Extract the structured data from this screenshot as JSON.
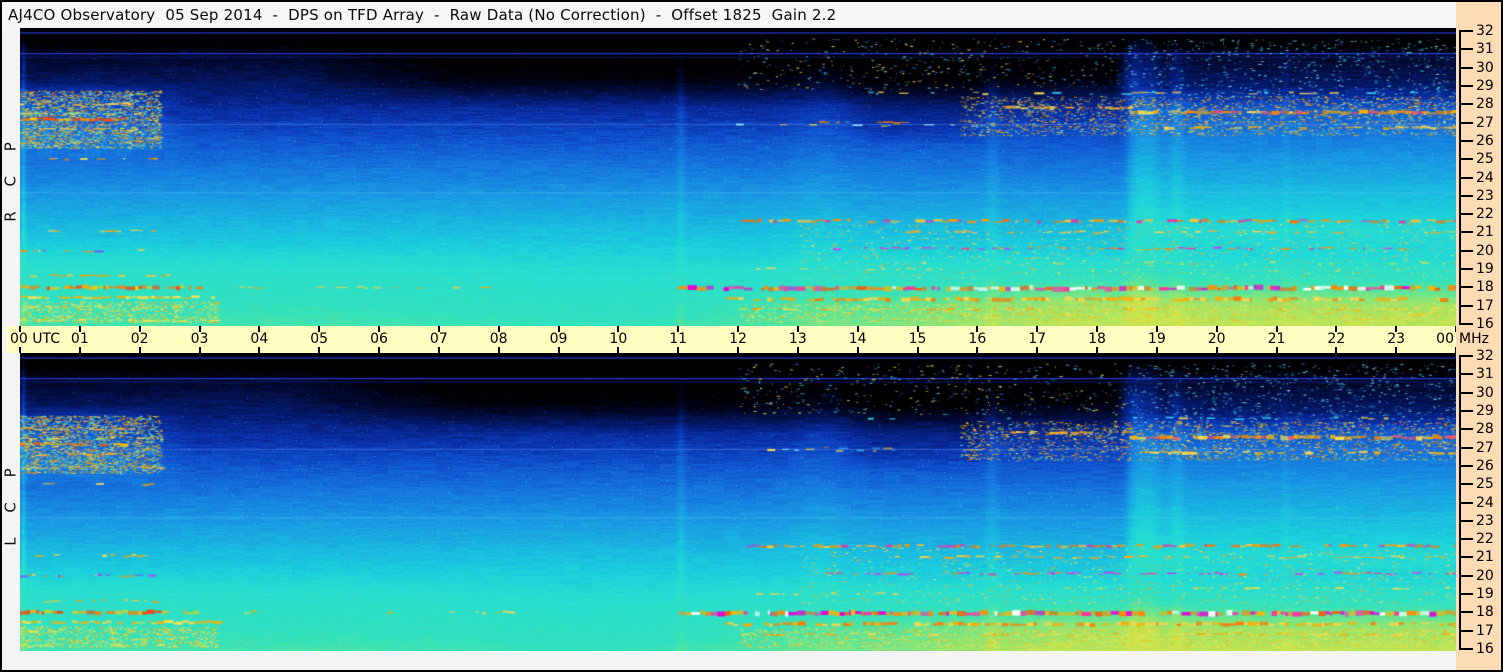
{
  "title": "AJ4CO Observatory  05 Sep 2014  -  DPS on TFD Array  -  Raw Data (No Correction)  -  Offset 1825  Gain 2.2",
  "panels": [
    {
      "id": "rcp",
      "label": "R C P",
      "noise_seed": 1234567
    },
    {
      "id": "lcp",
      "label": "L C P",
      "noise_seed": 7654321
    }
  ],
  "time_axis": {
    "labels": [
      "00 UTC",
      "01",
      "02",
      "03",
      "04",
      "05",
      "06",
      "07",
      "08",
      "09",
      "10",
      "11",
      "12",
      "13",
      "14",
      "15",
      "16",
      "17",
      "18",
      "19",
      "20",
      "21",
      "22",
      "23",
      "00"
    ]
  },
  "freq_axis": {
    "unit": "MHz",
    "ticks": [
      "32",
      "31",
      "30",
      "29",
      "28",
      "27",
      "26",
      "25",
      "24",
      "23",
      "22",
      "21",
      "20",
      "19",
      "18",
      "17",
      "16"
    ]
  },
  "colors": {
    "axis_band_bg": "#ffffc2",
    "sidebar_bg": "#fcdcb4",
    "page_bg": "#f4f4f4",
    "tick": "#000000",
    "text": "#000000"
  },
  "chart_data": {
    "type": "heatmap",
    "title": "AJ4CO Observatory dual-polarization dynamic spectrum (DPS on TFD Array), 05 Sep 2014, raw data, offset 1825, gain 2.2",
    "x": {
      "label": "UTC",
      "range_hours": [
        0,
        24
      ],
      "tick_step": 1
    },
    "y": {
      "label": "MHz",
      "range_mhz": [
        16,
        32
      ],
      "tick_step": 1,
      "orientation": "32 MHz at top"
    },
    "panel_series": [
      "RCP",
      "LCP"
    ],
    "notable_features": [
      "Interference/emission cluster 00:00-02:30 UTC between 25.5-28.7 MHz with red-orange line near 27.2 MHz (both polarizations)",
      "Quiet near-black region above ~28 MHz from ~05:00 until ~18:30 UTC, then brighter after 18:30",
      "Shortwave-band speckle 26.3-28.4 MHz strengthening after 16:00, dense orange band near 27.5 MHz after 18:30 UTC",
      "Strong broadband band near 18 MHz (orange/magenta/white) from 11:00 UTC to end of day",
      "Secondary bands near 21.6, 20.1 and 17.3 MHz in the afternoon sector",
      "Background gradient: black (32 MHz) through blue to cyan (16 MHz); becomes yellow-green at low frequencies late in the day",
      "Bright vertical columns near 18.6-19.0 and 19.3 UTC; faint light column at 11:00 UTC"
    ],
    "render": {
      "colormap": [
        {
          "p": 0.0,
          "c": "#000002"
        },
        {
          "p": 0.05,
          "c": "#01051a"
        },
        {
          "p": 0.1,
          "c": "#020a30"
        },
        {
          "p": 0.16,
          "c": "#041457"
        },
        {
          "p": 0.22,
          "c": "#06207f"
        },
        {
          "p": 0.28,
          "c": "#0a2fa5"
        },
        {
          "p": 0.34,
          "c": "#0e47c4"
        },
        {
          "p": 0.4,
          "c": "#1260d5"
        },
        {
          "p": 0.47,
          "c": "#167ade"
        },
        {
          "p": 0.54,
          "c": "#1992e2"
        },
        {
          "p": 0.61,
          "c": "#1aa9e2"
        },
        {
          "p": 0.68,
          "c": "#1bbfe0"
        },
        {
          "p": 0.75,
          "c": "#1dd3dc"
        },
        {
          "p": 0.83,
          "c": "#27ded0"
        },
        {
          "p": 0.92,
          "c": "#2ee0c6"
        },
        {
          "p": 1.0,
          "c": "#32e2c0"
        },
        {
          "p": 1.1,
          "c": "#55e59e"
        },
        {
          "p": 1.2,
          "c": "#8ce677"
        },
        {
          "p": 1.32,
          "c": "#c8e44e"
        }
      ],
      "regions": [
        {
          "t0": 4.5,
          "rt0": 3.0,
          "t1": 18.45,
          "rt1": 0.18,
          "f0": 27.8,
          "rf0": 1.6,
          "f1": 34.0,
          "rf1": 1.0,
          "amt": -0.145
        },
        {
          "t0": -2.0,
          "rt0": 0.1,
          "t1": 26.0,
          "rt1": 0.5,
          "f0": 30.7,
          "rf0": 0.9,
          "f1": 34.0,
          "rf1": 1.0,
          "amt": -0.1
        },
        {
          "t0": -2.0,
          "rt0": 0.1,
          "t1": 2.9,
          "rt1": 1.3,
          "f0": 24.8,
          "rf0": 1.3,
          "f1": 29.4,
          "rf1": 0.9,
          "amt": 0.1
        },
        {
          "t0": 10.5,
          "rt0": 7.0,
          "t1": 26.0,
          "rt1": 0.5,
          "f0": 15.0,
          "rf0": 0.5,
          "f1": 19.8,
          "rf1": 2.6,
          "amt": 0.3
        },
        {
          "t0": 18.45,
          "rt0": 0.3,
          "t1": 26.0,
          "rt1": 0.5,
          "f0": 19.5,
          "rf0": 1.6,
          "f1": 29.0,
          "rf1": 1.2,
          "amt": 0.12
        },
        {
          "t0": -2.0,
          "rt0": 0.1,
          "t1": 9.0,
          "rt1": 3.2,
          "f0": 15.0,
          "rf0": 0.5,
          "f1": 20.5,
          "rf1": 1.6,
          "amt": 0.05
        },
        {
          "t0": 13.7,
          "rt0": 0.6,
          "t1": 16.2,
          "rt1": 0.35,
          "f0": 25.5,
          "rf0": 1.2,
          "f1": 34.0,
          "rf1": 1.0,
          "amt": -0.04
        }
      ],
      "columns": [
        {
          "t": 0.05,
          "sigma": 0.03,
          "amt": 0.12
        },
        {
          "t": 11.04,
          "sigma": 0.05,
          "amt": 0.06
        },
        {
          "t": 13.35,
          "sigma": 0.35,
          "amt": 0.035
        },
        {
          "t": 16.25,
          "sigma": 0.08,
          "amt": 0.05
        },
        {
          "t": 18.62,
          "sigma": 0.1,
          "amt": 0.09
        },
        {
          "t": 18.88,
          "sigma": 0.12,
          "amt": 0.07
        },
        {
          "t": 19.33,
          "sigma": 0.09,
          "amt": 0.06
        },
        {
          "t": 21.15,
          "sigma": 0.05,
          "amt": 0.03
        }
      ],
      "h_lines": [
        {
          "f": 31.93,
          "c": "#2e47ff",
          "a": 0.75
        },
        {
          "f": 30.8,
          "c": "#2e47ff",
          "a": 0.8
        },
        {
          "f": 30.6,
          "c": "#1a2ba0",
          "a": 0.45
        },
        {
          "f": 26.93,
          "c": "#4f7df2",
          "a": 0.5
        },
        {
          "f": 23.2,
          "c": "#64c9f0",
          "a": 0.3
        },
        {
          "f": 19.0,
          "c": "#52e2e0",
          "a": 0.25
        },
        {
          "f": 18.55,
          "c": "#52e2e0",
          "a": 0.2
        }
      ],
      "features": [
        {
          "style": "dots",
          "t0": 0,
          "t1": 2.35,
          "f0": 25.6,
          "f1": 28.75,
          "count": 2400,
          "colors": [
            "#ffe34d",
            "#ffb300",
            "#74e6a8",
            "#30c8f0",
            "#ff8800"
          ]
        },
        {
          "style": "band",
          "f": 28.02,
          "t0": 0,
          "t1": 1.9,
          "h": 2,
          "d": 0.6,
          "colors": [
            "#ffd84d",
            "#ffaa22"
          ]
        },
        {
          "style": "band",
          "f": 27.5,
          "t0": 0,
          "t1": 2.15,
          "h": 2,
          "d": 0.55,
          "colors": [
            "#ffe14d",
            "#a2e87c"
          ]
        },
        {
          "style": "band",
          "f": 27.17,
          "t0": 0,
          "t1": 1.75,
          "h": 3,
          "d": 0.9,
          "colors": [
            "#ff4f00",
            "#ff8800",
            "#ffc400"
          ]
        },
        {
          "style": "band",
          "f": 26.62,
          "t0": 0,
          "t1": 1.95,
          "h": 2,
          "d": 0.6,
          "colors": [
            "#ffd84d",
            "#ffaa22"
          ]
        },
        {
          "style": "dashed",
          "f": 25.92,
          "t0": 0,
          "t1": 2.3,
          "h": 2,
          "d": 0.4,
          "colors": [
            "#ffe14d",
            "#ffb300"
          ]
        },
        {
          "style": "sparse",
          "f": 25.0,
          "t0": 0.1,
          "t1": 2.6,
          "h": 2,
          "d": 0.28,
          "colors": [
            "#ffe14d",
            "#ff9900"
          ]
        },
        {
          "style": "sparse",
          "f": 21.1,
          "t0": 0.25,
          "t1": 2.3,
          "h": 2,
          "d": 0.3,
          "colors": [
            "#ffe14d",
            "#ffaa00"
          ]
        },
        {
          "style": "dashed",
          "f": 20.0,
          "t0": 0,
          "t1": 2.25,
          "h": 2,
          "d": 0.5,
          "colors": [
            "#c433ff",
            "#ff8800",
            "#ffd84d",
            "#8040ff"
          ]
        },
        {
          "style": "dashed",
          "f": 18.62,
          "t0": 0,
          "t1": 2.45,
          "h": 2,
          "d": 0.5,
          "colors": [
            "#ff9900",
            "#ffcc33"
          ]
        },
        {
          "style": "band",
          "f": 18.0,
          "t0": 0,
          "t1": 3.05,
          "h": 4,
          "d": 0.8,
          "colors": [
            "#ff7700",
            "#ffaa00",
            "#ffd000",
            "#ff3c00"
          ]
        },
        {
          "style": "band",
          "f": 17.45,
          "t0": 0,
          "t1": 3.35,
          "h": 3,
          "d": 0.7,
          "colors": [
            "#ffb300",
            "#ffe14d"
          ]
        },
        {
          "style": "dashed",
          "f": 16.95,
          "t0": 0,
          "t1": 2.75,
          "h": 2,
          "d": 0.45,
          "colors": [
            "#ffe14d",
            "#cce860"
          ]
        },
        {
          "style": "dots",
          "t0": 0,
          "t1": 3.3,
          "f0": 16.1,
          "f1": 17.25,
          "count": 850,
          "colors": [
            "#ffe14d",
            "#d8e85a",
            "#ffb300"
          ]
        },
        {
          "style": "band",
          "f": 16.18,
          "t0": 0,
          "t1": 3.2,
          "h": 2,
          "d": 0.5,
          "colors": [
            "#ffe14d",
            "#d8e85a"
          ]
        },
        {
          "style": "dashed",
          "f": 18.0,
          "t0": 3.05,
          "t1": 8.2,
          "h": 2,
          "d": 0.18,
          "colors": [
            "#ffd84d",
            "#ffaa00"
          ]
        },
        {
          "style": "sparse",
          "f": 26.85,
          "t0": 11.9,
          "t1": 16.2,
          "h": 2,
          "d": 0.25,
          "colors": [
            "#38d4f2",
            "#90ecff",
            "#ffe14d"
          ]
        },
        {
          "style": "dashed",
          "f": 26.98,
          "t0": 13.15,
          "t1": 14.8,
          "h": 2,
          "d": 0.5,
          "colors": [
            "#ffcc33",
            "#ff8800",
            "#38d4f2"
          ]
        },
        {
          "style": "dots",
          "t0": 12,
          "t1": 18.5,
          "f0": 28.8,
          "f1": 31.6,
          "count": 420,
          "colors": [
            "#2a7fe0",
            "#38d4f2",
            "#ffe14d"
          ]
        },
        {
          "style": "dots",
          "t0": 18.5,
          "t1": 24,
          "f0": 28.4,
          "f1": 31.6,
          "count": 650,
          "colors": [
            "#2a7fe0",
            "#38d4f2",
            "#8ce8ff"
          ]
        },
        {
          "style": "dots",
          "t0": 15.7,
          "t1": 24,
          "f0": 26.3,
          "f1": 28.45,
          "count": 2100,
          "colors": [
            "#ffe14d",
            "#ffb300",
            "#ff8800",
            "#66e0c8"
          ]
        },
        {
          "style": "band",
          "f": 27.55,
          "t0": 18.55,
          "t1": 24,
          "h": 4,
          "d": 0.9,
          "colors": [
            "#ffb300",
            "#ff8800",
            "#ffe14d",
            "#ff5566"
          ]
        },
        {
          "style": "band",
          "f": 27.82,
          "t0": 16.2,
          "t1": 18.55,
          "h": 3,
          "d": 0.5,
          "colors": [
            "#ffd84d",
            "#ffaa22"
          ]
        },
        {
          "style": "band",
          "f": 26.72,
          "t0": 18.8,
          "t1": 24,
          "h": 3,
          "d": 0.55,
          "colors": [
            "#ffb300",
            "#ffd84d"
          ]
        },
        {
          "style": "sparse",
          "f": 28.6,
          "t0": 14,
          "t1": 24,
          "h": 2,
          "d": 0.18,
          "colors": [
            "#ffd84d",
            "#38d4f2"
          ]
        },
        {
          "style": "band",
          "f": 21.62,
          "t0": 12.05,
          "t1": 24,
          "h": 3,
          "d": 0.7,
          "colors": [
            "#ff9900",
            "#ffc433",
            "#ff6f00",
            "#e832aa"
          ]
        },
        {
          "style": "dashed",
          "f": 21.02,
          "t0": 14.2,
          "t1": 24,
          "h": 2,
          "d": 0.4,
          "colors": [
            "#ffaa22",
            "#ffd84d"
          ]
        },
        {
          "style": "dashed",
          "f": 20.12,
          "t0": 13.3,
          "t1": 24,
          "h": 2,
          "d": 0.45,
          "colors": [
            "#e832aa",
            "#c433ff",
            "#ff8800"
          ]
        },
        {
          "style": "sparse",
          "f": 19.0,
          "t0": 12.3,
          "t1": 15.3,
          "h": 2,
          "d": 0.28,
          "colors": [
            "#ffd84d"
          ]
        },
        {
          "style": "sparse",
          "f": 19.32,
          "t0": 16.5,
          "t1": 24,
          "h": 2,
          "d": 0.22,
          "colors": [
            "#ffd84d",
            "#b2e85e"
          ]
        },
        {
          "style": "band",
          "f": 17.95,
          "t0": 11.0,
          "t1": 24,
          "h": 5,
          "d": 0.92,
          "colors": [
            "#ff8800",
            "#ff2f9e",
            "#e800d0",
            "#ffb300",
            "#ffffff",
            "#ff5500"
          ]
        },
        {
          "style": "band",
          "f": 17.35,
          "t0": 11.8,
          "t1": 24,
          "h": 4,
          "d": 0.78,
          "colors": [
            "#ffaa00",
            "#ffd84d",
            "#ff7700"
          ]
        },
        {
          "style": "dashed",
          "f": 16.8,
          "t0": 12,
          "t1": 24,
          "h": 2,
          "d": 0.45,
          "colors": [
            "#ffd84d",
            "#cce860",
            "#ff9900"
          ]
        },
        {
          "style": "dots",
          "t0": 12,
          "t1": 24,
          "f0": 16.1,
          "f1": 17.15,
          "count": 1500,
          "colors": [
            "#ffe14d",
            "#d8e85a",
            "#ffb300"
          ]
        },
        {
          "style": "dots",
          "t0": 13,
          "t1": 24,
          "f0": 18.5,
          "f1": 21.6,
          "count": 1100,
          "colors": [
            "#ffe14d",
            "#74e6a8",
            "#ffaa22"
          ]
        }
      ]
    }
  }
}
